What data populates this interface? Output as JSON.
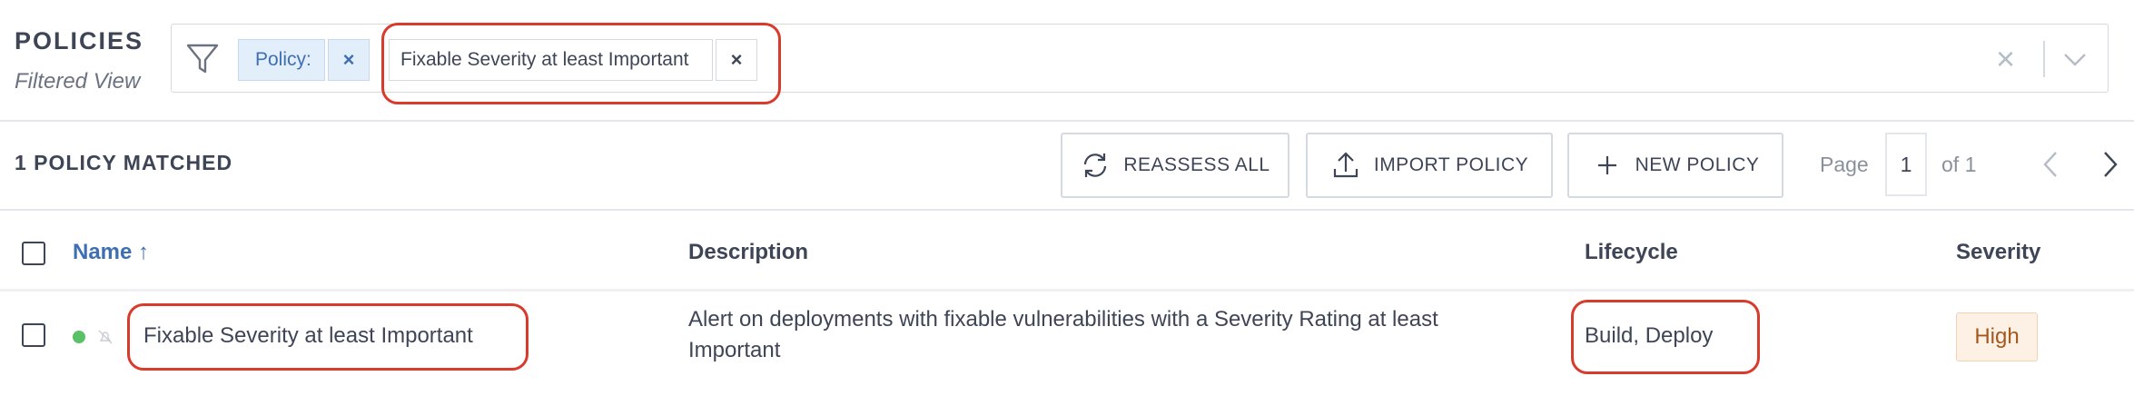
{
  "header": {
    "title": "POLICIES",
    "subtitle": "Filtered View"
  },
  "filter": {
    "chip_key": "Policy:",
    "chip_value": "Fixable Severity at least Important",
    "remove_glyph": "×",
    "clear_glyph": "×"
  },
  "toolbar": {
    "matched_count": "1 POLICY MATCHED",
    "reassess_label": "REASSESS ALL",
    "import_label": "IMPORT POLICY",
    "new_label": "NEW POLICY"
  },
  "pagination": {
    "page_label": "Page",
    "current_page": "1",
    "of_label": "of 1"
  },
  "table": {
    "columns": [
      "Name ↑",
      "Description",
      "Lifecycle",
      "Severity"
    ],
    "rows": [
      {
        "name": "Fixable Severity at least Important",
        "description_line1": "Alert on deployments with fixable vulnerabilities with a Severity Rating at least",
        "description_line2": "Important",
        "lifecycle": "Build, Deploy",
        "severity": "High"
      }
    ]
  },
  "colors": {
    "accent": "#3f6fb3",
    "highlight": "#d93a2b",
    "status_enabled": "#59c266",
    "severity_high_text": "#a5581d",
    "severity_high_bg": "#fdf1e6"
  },
  "icons": [
    "filter-icon",
    "close-icon",
    "chevron-down-icon",
    "refresh-icon",
    "upload-icon",
    "plus-icon",
    "chevron-left-icon",
    "chevron-right-icon",
    "notification-off-icon"
  ]
}
